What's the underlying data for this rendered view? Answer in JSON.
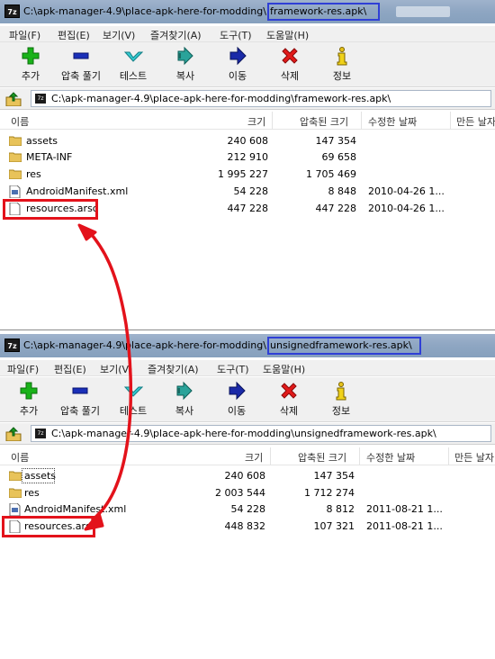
{
  "windows": [
    {
      "title": {
        "app_icon": "7z",
        "path_prefix": "C:\\apk-manager-4.9\\place-apk-here-for-modding\\",
        "archive": "framework-res.apk\\"
      },
      "menu": [
        "파일(F)",
        "편집(E)",
        "보기(V)",
        "즐겨찾기(A)",
        "도구(T)",
        "도움말(H)"
      ],
      "toolbar": [
        {
          "label": "추가",
          "icon": "add-icon"
        },
        {
          "label": "압축 풀기",
          "icon": "extract-icon"
        },
        {
          "label": "테스트",
          "icon": "test-icon"
        },
        {
          "label": "복사",
          "icon": "copy-icon"
        },
        {
          "label": "이동",
          "icon": "move-icon"
        },
        {
          "label": "삭제",
          "icon": "delete-icon"
        },
        {
          "label": "정보",
          "icon": "info-icon"
        }
      ],
      "address": "C:\\apk-manager-4.9\\place-apk-here-for-modding\\framework-res.apk\\",
      "columns": [
        "이름",
        "크기",
        "압축된 크기",
        "수정한 날짜",
        "만든 날자"
      ],
      "files": [
        {
          "name": "assets",
          "size": "240 608",
          "packed": "147 354",
          "modified": "",
          "type": "folder"
        },
        {
          "name": "META-INF",
          "size": "212 910",
          "packed": "69 658",
          "modified": "",
          "type": "folder"
        },
        {
          "name": "res",
          "size": "1 995 227",
          "packed": "1 705 469",
          "modified": "",
          "type": "folder"
        },
        {
          "name": "AndroidManifest.xml",
          "size": "54 228",
          "packed": "8 848",
          "modified": "2010-04-26 1...",
          "type": "xml"
        },
        {
          "name": "resources.arsc",
          "size": "447 228",
          "packed": "447 228",
          "modified": "2010-04-26 1...",
          "type": "file"
        }
      ]
    },
    {
      "title": {
        "app_icon": "7z",
        "path_prefix": "C:\\apk-manager-4.9\\place-apk-here-for-modding\\",
        "archive": "unsignedframework-res.apk\\"
      },
      "menu": [
        "파일(F)",
        "편집(E)",
        "보기(V)",
        "즐겨찾기(A)",
        "도구(T)",
        "도움말(H)"
      ],
      "toolbar": [
        {
          "label": "추가",
          "icon": "add-icon"
        },
        {
          "label": "압축 풀기",
          "icon": "extract-icon"
        },
        {
          "label": "테스트",
          "icon": "test-icon"
        },
        {
          "label": "복사",
          "icon": "copy-icon"
        },
        {
          "label": "이동",
          "icon": "move-icon"
        },
        {
          "label": "삭제",
          "icon": "delete-icon"
        },
        {
          "label": "정보",
          "icon": "info-icon"
        }
      ],
      "address": "C:\\apk-manager-4.9\\place-apk-here-for-modding\\unsignedframework-res.apk\\",
      "columns": [
        "이름",
        "크기",
        "압축된 크기",
        "수정한 날짜",
        "만든 날자"
      ],
      "files": [
        {
          "name": "assets",
          "size": "240 608",
          "packed": "147 354",
          "modified": "",
          "type": "folder"
        },
        {
          "name": "res",
          "size": "2 003 544",
          "packed": "1 712 274",
          "modified": "",
          "type": "folder"
        },
        {
          "name": "AndroidManifest.xml",
          "size": "54 228",
          "packed": "8 812",
          "modified": "2011-08-21 1...",
          "type": "xml"
        },
        {
          "name": "resources.arsc",
          "size": "448 832",
          "packed": "107 321",
          "modified": "2011-08-21 1...",
          "type": "file"
        }
      ]
    }
  ],
  "colors": {
    "highlight_box": "#2f3fd6",
    "annotation_red": "#e3121b"
  }
}
